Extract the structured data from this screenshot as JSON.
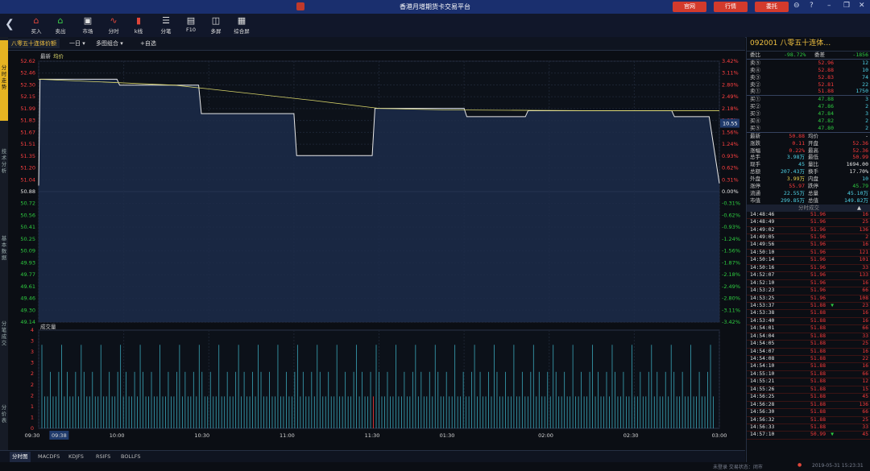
{
  "window": {
    "title": "香港月增期货卡交易平台",
    "buttons": [
      "官网",
      "行情",
      "委托"
    ],
    "controls": [
      "⊖",
      "?",
      "–",
      "❐",
      "✕"
    ]
  },
  "toolbar": {
    "items": [
      {
        "label": "买入",
        "icon": "buy-icon"
      },
      {
        "label": "卖出",
        "icon": "sell-icon"
      },
      {
        "label": "市场",
        "icon": "market-icon"
      },
      {
        "label": "分时",
        "icon": "intraday-icon"
      },
      {
        "label": "k线",
        "icon": "kline-icon"
      },
      {
        "label": "分笔",
        "icon": "ticks-icon"
      },
      {
        "label": "F10",
        "icon": "f10-icon"
      },
      {
        "label": "多屏",
        "icon": "multiscreen-icon"
      },
      {
        "label": "综合屏",
        "icon": "composite-icon"
      }
    ]
  },
  "sidebar": {
    "tabs": [
      "分时走势",
      "技术分析",
      "基本数据",
      "分笔成交",
      "分价表"
    ]
  },
  "tabbar": {
    "name": "八零五十连体价额",
    "period": "一日",
    "overlay": "多图组合",
    "add": "+自选"
  },
  "chart": {
    "legend": [
      "最新",
      "均价"
    ],
    "volume_label": "成交量",
    "hover_price": "10.55"
  },
  "chart_data": {
    "type": "line",
    "x_ticks": [
      "09:30",
      "09:38",
      "10:00",
      "10:30",
      "11:00",
      "11:30",
      "01:30",
      "02:00",
      "02:30",
      "03:00"
    ],
    "y_left_ticks": [
      "52.62",
      "52.46",
      "52.30",
      "52.15",
      "51.99",
      "51.83",
      "51.67",
      "51.51",
      "51.35",
      "51.20",
      "51.04",
      "50.88",
      "50.72",
      "50.56",
      "50.41",
      "50.25",
      "50.09",
      "49.93",
      "49.77",
      "49.61",
      "49.46",
      "49.30",
      "49.14"
    ],
    "y_right_ticks": [
      "3.42%",
      "3.11%",
      "2.80%",
      "2.49%",
      "2.18%",
      "1.87%",
      "1.56%",
      "1.24%",
      "0.93%",
      "0.62%",
      "0.31%",
      "0.00%",
      "-0.31%",
      "-0.62%",
      "-0.93%",
      "-1.24%",
      "-1.56%",
      "-1.87%",
      "-2.18%",
      "-2.49%",
      "-2.80%",
      "-3.11%",
      "-3.42%"
    ],
    "ylim": [
      49.14,
      52.62
    ],
    "base": 50.88,
    "x": [
      0,
      0.002,
      0.115,
      0.119,
      0.235,
      0.239,
      0.375,
      0.379,
      0.49,
      0.494,
      0.625,
      0.629,
      0.715,
      0.719,
      0.93,
      0.934,
      0.985,
      1.0
    ],
    "series": [
      {
        "name": "最新",
        "values": [
          50.96,
          52.38,
          52.38,
          52.3,
          52.3,
          51.92,
          51.92,
          51.36,
          51.36,
          51.99,
          51.99,
          51.88,
          51.88,
          51.96,
          51.96,
          51.88,
          51.88,
          50.99
        ]
      }
    ],
    "avg_x": [
      0,
      0.2,
      0.4,
      0.5,
      0.6,
      0.8,
      1.0
    ],
    "avg_values": [
      52.38,
      52.3,
      52.1,
      51.99,
      51.97,
      51.96,
      51.96
    ],
    "volume_ylim": [
      0,
      4
    ],
    "volume_ticks": [
      "4",
      "3",
      "3",
      "3",
      "2",
      "2",
      "2",
      "1",
      "1",
      "0"
    ]
  },
  "bottom_tabs": [
    "分时图",
    "MACDFS",
    "KDJFS",
    "RSIFS",
    "BOLLFS"
  ],
  "status": {
    "left": "未登录   交易状态：闭市",
    "time": "2019-05-31 15:23:31"
  },
  "quote": {
    "code": "092001",
    "name": "八零五十连体…",
    "ratio": {
      "label": "委比",
      "value": "-98.72%",
      "diff_label": "委差",
      "diff": "-1856"
    },
    "asks": [
      {
        "label": "卖⑤",
        "price": "52.96",
        "vol": "12"
      },
      {
        "label": "卖④",
        "price": "52.88",
        "vol": "10"
      },
      {
        "label": "卖③",
        "price": "52.83",
        "vol": "74"
      },
      {
        "label": "卖②",
        "price": "52.81",
        "vol": "22"
      },
      {
        "label": "卖①",
        "price": "51.88",
        "vol": "1750"
      }
    ],
    "bids": [
      {
        "label": "买①",
        "price": "47.88",
        "vol": "3"
      },
      {
        "label": "买②",
        "price": "47.86",
        "vol": "2"
      },
      {
        "label": "买③",
        "price": "47.84",
        "vol": "3"
      },
      {
        "label": "买④",
        "price": "47.82",
        "vol": "2"
      },
      {
        "label": "买⑤",
        "price": "47.80",
        "vol": "2"
      }
    ],
    "stats": [
      {
        "l1": "最新",
        "v1": "50.88",
        "l2": "均价",
        "v2": "-",
        "c1": "red",
        "c2": "white"
      },
      {
        "l1": "涨跌",
        "v1": "0.11",
        "l2": "开盘",
        "v2": "52.36",
        "c1": "red",
        "c2": "red"
      },
      {
        "l1": "涨幅",
        "v1": "0.22%",
        "l2": "最高",
        "v2": "52.36",
        "c1": "red",
        "c2": "red"
      },
      {
        "l1": "总手",
        "v1": "3.98万",
        "l2": "最低",
        "v2": "50.99",
        "c1": "cyan",
        "c2": "red"
      },
      {
        "l1": "现手",
        "v1": "45",
        "l2": "量比",
        "v2": "1694.00",
        "c1": "cyan",
        "c2": "white"
      },
      {
        "l1": "总额",
        "v1": "207.43万",
        "l2": "换手",
        "v2": "17.70%",
        "c1": "cyan",
        "c2": "white"
      },
      {
        "l1": "外盘",
        "v1": "3.99万",
        "l2": "内盘",
        "v2": "10",
        "c1": "yellow",
        "c2": "cyan"
      },
      {
        "l1": "涨停",
        "v1": "55.97",
        "l2": "跌停",
        "v2": "45.79",
        "c1": "red",
        "c2": "green"
      },
      {
        "l1": "流通",
        "v1": "22.55万",
        "l2": "总量",
        "v2": "45.10万",
        "c1": "cyan",
        "c2": "cyan"
      },
      {
        "l1": "市值",
        "v1": "299.85万",
        "l2": "总值",
        "v2": "149.82万",
        "c1": "cyan",
        "c2": "cyan"
      }
    ],
    "ticks_header": "分时成交",
    "ticks": [
      {
        "t": "14:48:46",
        "p": "51.96",
        "v": "16",
        "d": ""
      },
      {
        "t": "14:48:49",
        "p": "51.96",
        "v": "25",
        "d": ""
      },
      {
        "t": "14:49:02",
        "p": "51.96",
        "v": "136",
        "d": ""
      },
      {
        "t": "14:49:05",
        "p": "51.96",
        "v": "2",
        "d": ""
      },
      {
        "t": "14:49:56",
        "p": "51.96",
        "v": "16",
        "d": ""
      },
      {
        "t": "14:50:10",
        "p": "51.96",
        "v": "121",
        "d": ""
      },
      {
        "t": "14:50:14",
        "p": "51.96",
        "v": "101",
        "d": ""
      },
      {
        "t": "14:50:16",
        "p": "51.96",
        "v": "33",
        "d": ""
      },
      {
        "t": "14:52:07",
        "p": "51.96",
        "v": "133",
        "d": ""
      },
      {
        "t": "14:52:10",
        "p": "51.96",
        "v": "16",
        "d": ""
      },
      {
        "t": "14:53:23",
        "p": "51.96",
        "v": "66",
        "d": ""
      },
      {
        "t": "14:53:25",
        "p": "51.96",
        "v": "108",
        "d": ""
      },
      {
        "t": "14:53:37",
        "p": "51.88",
        "v": "23",
        "d": "▼"
      },
      {
        "t": "14:53:38",
        "p": "51.88",
        "v": "16",
        "d": ""
      },
      {
        "t": "14:53:40",
        "p": "51.88",
        "v": "16",
        "d": ""
      },
      {
        "t": "14:54:01",
        "p": "51.88",
        "v": "66",
        "d": ""
      },
      {
        "t": "14:54:04",
        "p": "51.88",
        "v": "33",
        "d": ""
      },
      {
        "t": "14:54:05",
        "p": "51.88",
        "v": "25",
        "d": ""
      },
      {
        "t": "14:54:07",
        "p": "51.88",
        "v": "16",
        "d": ""
      },
      {
        "t": "14:54:08",
        "p": "51.88",
        "v": "22",
        "d": ""
      },
      {
        "t": "14:54:10",
        "p": "51.88",
        "v": "16",
        "d": ""
      },
      {
        "t": "14:55:10",
        "p": "51.88",
        "v": "66",
        "d": ""
      },
      {
        "t": "14:55:21",
        "p": "51.88",
        "v": "12",
        "d": ""
      },
      {
        "t": "14:55:26",
        "p": "51.88",
        "v": "15",
        "d": ""
      },
      {
        "t": "14:56:25",
        "p": "51.88",
        "v": "45",
        "d": ""
      },
      {
        "t": "14:56:28",
        "p": "51.88",
        "v": "136",
        "d": ""
      },
      {
        "t": "14:56:30",
        "p": "51.88",
        "v": "66",
        "d": ""
      },
      {
        "t": "14:56:32",
        "p": "51.88",
        "v": "25",
        "d": ""
      },
      {
        "t": "14:56:33",
        "p": "51.88",
        "v": "33",
        "d": ""
      },
      {
        "t": "14:57:10",
        "p": "50.99",
        "v": "45",
        "d": "▼"
      }
    ]
  }
}
